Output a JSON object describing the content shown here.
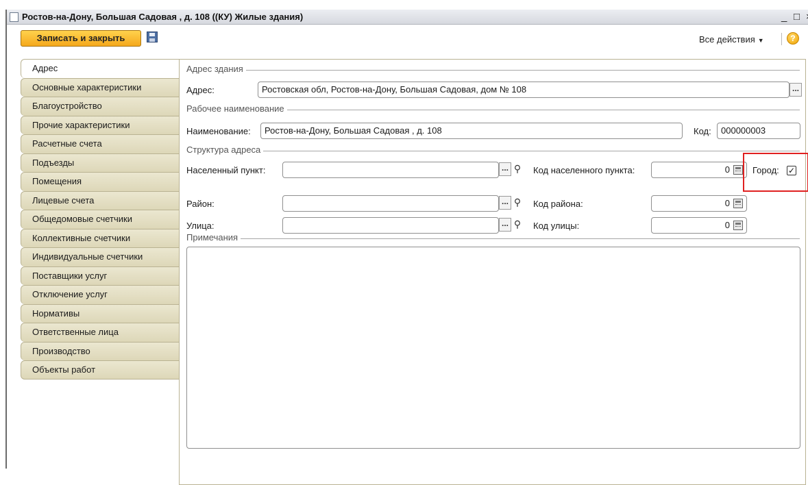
{
  "window": {
    "title": "Ростов-на-Дону, Большая Садовая , д. 108 ((КУ) Жилые здания)",
    "minimize_glyph": "_",
    "maximize_glyph": "□",
    "close_glyph": "×"
  },
  "toolbar": {
    "save_close_label": "Записать и закрыть",
    "all_actions_label": "Все действия",
    "help_glyph": "?"
  },
  "tabs": [
    {
      "label": "Адрес",
      "active": true
    },
    {
      "label": "Основные характеристики"
    },
    {
      "label": "Благоустройство"
    },
    {
      "label": "Прочие характеристики"
    },
    {
      "label": "Расчетные счета"
    },
    {
      "label": "Подъезды"
    },
    {
      "label": "Помещения"
    },
    {
      "label": "Лицевые счета"
    },
    {
      "label": "Общедомовые счетчики"
    },
    {
      "label": "Коллективные счетчики"
    },
    {
      "label": "Индивидуальные счетчики"
    },
    {
      "label": "Поставщики услуг"
    },
    {
      "label": "Отключение услуг"
    },
    {
      "label": "Нормативы"
    },
    {
      "label": "Ответственные лица"
    },
    {
      "label": "Производство"
    },
    {
      "label": "Объекты работ"
    }
  ],
  "address_section": {
    "group_title": "Адрес здания",
    "address_label": "Адрес:",
    "address_value": "Ростовская обл, Ростов-на-Дону, Большая Садовая, дом № 108"
  },
  "working_name_section": {
    "group_title": "Рабочее наименование",
    "name_label": "Наименование:",
    "name_value": "Ростов-на-Дону, Большая Садовая , д. 108",
    "code_label": "Код:",
    "code_value": "000000003"
  },
  "structure_section": {
    "group_title": "Структура адреса",
    "settlement_label": "Населенный пункт:",
    "settlement_value": "",
    "settlement_code_label": "Код населенного пункта:",
    "settlement_code_value": "0",
    "city_label": "Город:",
    "city_checked": true,
    "district_label": "Район:",
    "district_value": "",
    "district_code_label": "Код района:",
    "district_code_value": "0",
    "street_label": "Улица:",
    "street_value": "",
    "street_code_label": "Код улицы:",
    "street_code_value": "0"
  },
  "notes_section": {
    "group_title": "Примечания",
    "notes_value": ""
  },
  "glyphs": {
    "ellipsis": "...",
    "magnifier": "⚲",
    "check": "✓"
  }
}
